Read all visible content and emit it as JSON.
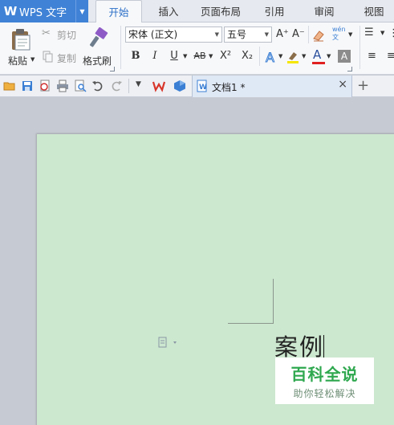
{
  "app": {
    "title": "WPS 文字",
    "logo_letter": "W"
  },
  "tabs": [
    {
      "label": "开始",
      "active": true
    },
    {
      "label": "插入",
      "active": false
    },
    {
      "label": "页面布局",
      "active": false
    },
    {
      "label": "引用",
      "active": false
    },
    {
      "label": "审阅",
      "active": false
    },
    {
      "label": "视图",
      "active": false
    }
  ],
  "ribbon": {
    "paste_label": "粘贴",
    "cut_label": "剪切",
    "copy_label": "复制",
    "format_painter_label": "格式刷",
    "font_name": "宋体 (正文)",
    "font_size": "五号",
    "bold": "B",
    "italic": "I",
    "underline": "U",
    "strikethrough": "AB",
    "superscript": "X²",
    "subscript": "X₂",
    "font_color_letter": "A",
    "grow_font": "A⁺",
    "shrink_font": "A⁻",
    "phonetic_label": "wén 文"
  },
  "quickbar": {
    "document_tab": "文档1 *",
    "close_glyph": "×",
    "new_tab_glyph": "+"
  },
  "document": {
    "text": "案例"
  },
  "watermark": {
    "line1": "百科全说",
    "line2": "助你轻松解决"
  },
  "colors": {
    "accent": "#3f82d6",
    "page_bg": "#cce8cf",
    "watermark_green": "#2fa84f"
  }
}
